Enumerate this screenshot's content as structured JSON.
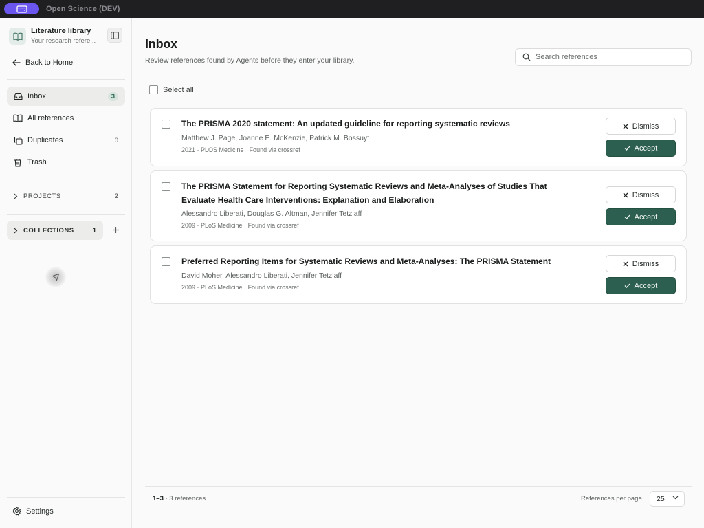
{
  "window": {
    "title": "Open Science (DEV)"
  },
  "sidebar": {
    "library_title": "Literature library",
    "library_subtitle": "Your research refere...",
    "back_label": "Back to Home",
    "items": [
      {
        "label": "Inbox",
        "count": "3",
        "icon": "inbox-icon",
        "active": true
      },
      {
        "label": "All references",
        "count": "",
        "icon": "book-open-icon"
      },
      {
        "label": "Duplicates",
        "count": "0",
        "icon": "copy-icon"
      },
      {
        "label": "Trash",
        "count": "",
        "icon": "trash-icon"
      }
    ],
    "projects": {
      "label": "PROJECTS",
      "count": "2"
    },
    "collections": {
      "label": "COLLECTIONS",
      "count": "1"
    },
    "settings_label": "Settings"
  },
  "main": {
    "title": "Inbox",
    "subtitle": "Review references found by Agents before they enter your library.",
    "search_placeholder": "Search references",
    "select_all_label": "Select all",
    "dismiss_label": "Dismiss",
    "accept_label": "Accept",
    "references": [
      {
        "title": "The PRISMA 2020 statement: An updated guideline for reporting systematic reviews",
        "authors": "Matthew J. Page, Joanne E. McKenzie, Patrick M. Bossuyt",
        "year_journal": "2021 · PLOS Medicine",
        "source": "Found via crossref"
      },
      {
        "title": "The PRISMA Statement for Reporting Systematic Reviews and Meta-Analyses of Studies That Evaluate Health Care Interventions: Explanation and Elaboration",
        "authors": "Alessandro Liberati, Douglas G. Altman, Jennifer Tetzlaff",
        "year_journal": "2009 · PLoS Medicine",
        "source": "Found via crossref"
      },
      {
        "title": "Preferred Reporting Items for Systematic Reviews and Meta-Analyses: The PRISMA Statement",
        "authors": "David Moher, Alessandro Liberati, Jennifer Tetzlaff",
        "year_journal": "2009 · PLoS Medicine",
        "source": "Found via crossref"
      }
    ],
    "footer": {
      "range": "1–3",
      "total": " · 3 references",
      "per_page_label": "References per page",
      "per_page_value": "25"
    }
  },
  "colors": {
    "accent": "#2c5f50",
    "app_badge": "#6b56f0",
    "inbox_badge_bg": "#d6e4dd"
  }
}
